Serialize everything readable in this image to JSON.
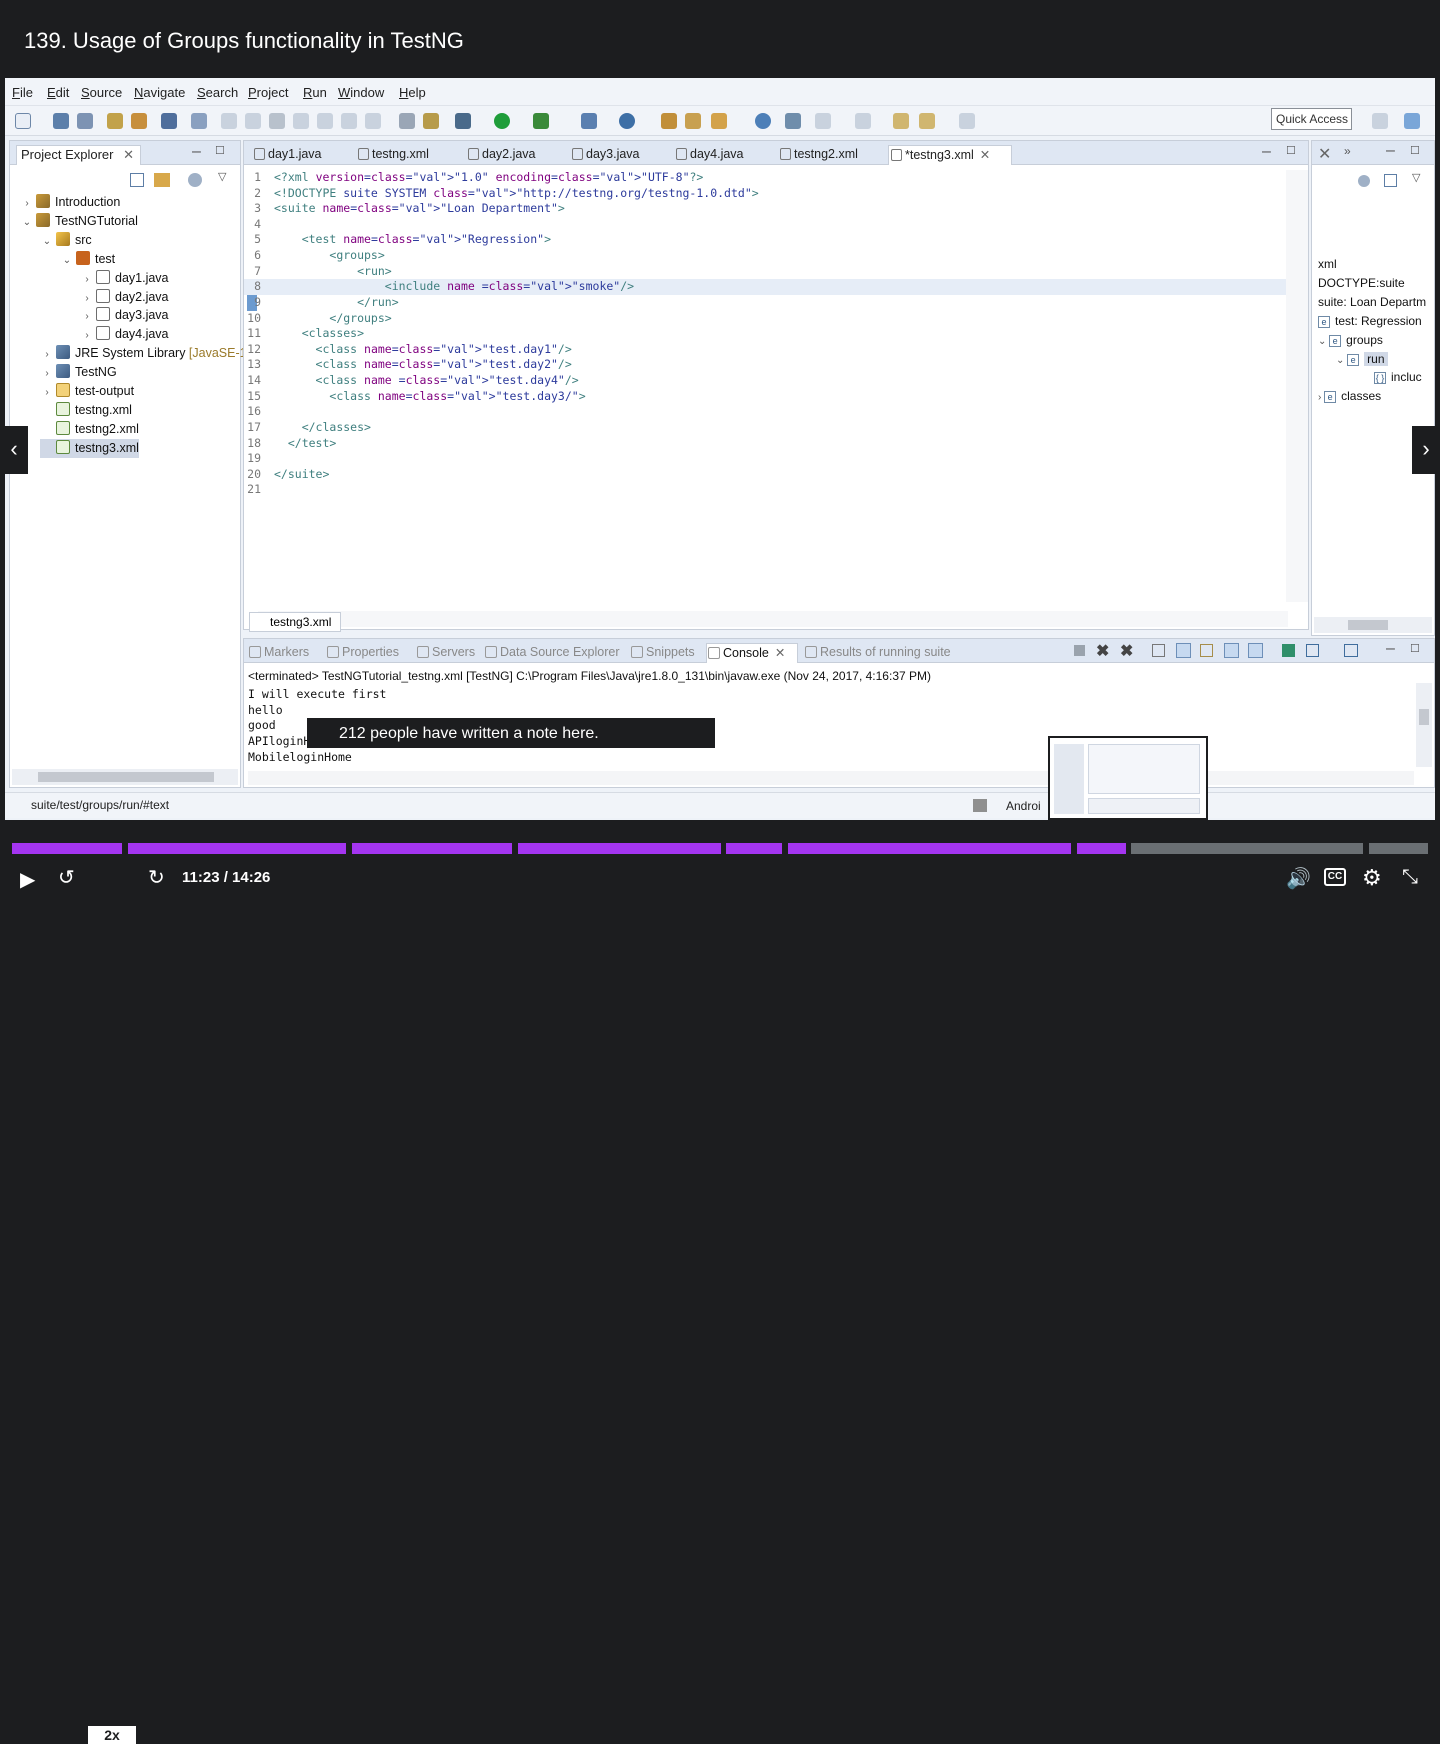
{
  "lecture": {
    "title": "139. Usage of Groups functionality in TestNG"
  },
  "menubar": {
    "items": [
      "File",
      "Edit",
      "Source",
      "Navigate",
      "Search",
      "Project",
      "Run",
      "Window",
      "Help"
    ]
  },
  "toolbar": {
    "quick_access": "Quick Access"
  },
  "project_explorer": {
    "tab_label": "Project Explorer",
    "items": [
      {
        "label": "Introduction",
        "depth": 0,
        "arrow": "›",
        "icon": "project-icon"
      },
      {
        "label": "TestNGTutorial",
        "depth": 0,
        "arrow": "⌄",
        "icon": "project-icon"
      },
      {
        "label": "src",
        "depth": 1,
        "arrow": "⌄",
        "icon": "source-folder-icon"
      },
      {
        "label": "test",
        "depth": 2,
        "arrow": "⌄",
        "icon": "package-icon"
      },
      {
        "label": "day1.java",
        "depth": 3,
        "arrow": "›",
        "icon": "java-file-icon"
      },
      {
        "label": "day2.java",
        "depth": 3,
        "arrow": "›",
        "icon": "java-file-icon"
      },
      {
        "label": "day3.java",
        "depth": 3,
        "arrow": "›",
        "icon": "java-file-icon"
      },
      {
        "label": "day4.java",
        "depth": 3,
        "arrow": "›",
        "icon": "java-file-icon"
      },
      {
        "label": "JRE System Library",
        "suffix": "[JavaSE-1.",
        "depth": 1,
        "arrow": "›",
        "icon": "library-icon"
      },
      {
        "label": "TestNG",
        "depth": 1,
        "arrow": "›",
        "icon": "library-icon"
      },
      {
        "label": "test-output",
        "depth": 1,
        "arrow": "›",
        "icon": "folder-icon"
      },
      {
        "label": "testng.xml",
        "depth": 1,
        "arrow": "",
        "icon": "xml-file-icon"
      },
      {
        "label": "testng2.xml",
        "depth": 1,
        "arrow": "",
        "icon": "xml-file-icon"
      },
      {
        "label": "testng3.xml",
        "depth": 1,
        "arrow": "",
        "icon": "xml-file-icon",
        "selected": true
      }
    ]
  },
  "editor": {
    "tabs": [
      "day1.java",
      "testng.xml",
      "day2.java",
      "day3.java",
      "day4.java",
      "testng2.xml",
      "*testng3.xml"
    ],
    "active_tab": "*testng3.xml",
    "bottom_tab": "testng3.xml",
    "highlighted_line": 8,
    "lines": [
      "<?xml version=\"1.0\" encoding=\"UTF-8\"?>",
      "<!DOCTYPE suite SYSTEM \"http://testng.org/testng-1.0.dtd\">",
      "<suite name=\"Loan Department\">",
      "",
      "    <test name=\"Regression\">",
      "        <groups>",
      "            <run>",
      "                <include name =\"smoke\"/>",
      "            </run>",
      "        </groups>",
      "    <classes>",
      "      <class name=\"test.day1\"/>",
      "      <class name=\"test.day2\"/>",
      "      <class name =\"test.day4\"/>",
      "        <class name=\"test.day3/\">",
      "",
      "    </classes>",
      "  </test>",
      "",
      "</suite>",
      ""
    ]
  },
  "outline": {
    "items": [
      {
        "label": "xml",
        "icon": ""
      },
      {
        "label": "DOCTYPE:suite",
        "icon": ""
      },
      {
        "label": "suite: Loan Departm",
        "icon": ""
      },
      {
        "label": "test: Regression",
        "icon": "e"
      },
      {
        "label": "groups",
        "icon": "e",
        "arrow": "⌄"
      },
      {
        "label": "run",
        "icon": "e",
        "arrow": "⌄"
      },
      {
        "label": "incluc",
        "icon": "{ }"
      },
      {
        "label": "classes",
        "icon": "e",
        "arrow": "›"
      }
    ]
  },
  "console": {
    "tabs": [
      "Markers",
      "Properties",
      "Servers",
      "Data Source Explorer",
      "Snippets",
      "Console",
      "Results of running suite"
    ],
    "active_tab": "Console",
    "header": "<terminated> TestNGTutorial_testng.xml [TestNG] C:\\Program Files\\Java\\jre1.8.0_131\\bin\\javaw.exe (Nov 24, 2017, 4:16:37 PM)",
    "output": "I will execute first\nhello\ngood\nAPIloginHome\nMobileloginHome"
  },
  "statusbar": {
    "path": "suite/test/groups/run/#text",
    "android": "Androi"
  },
  "note_banner": "212 people have written a note here.",
  "player": {
    "speed": "2x",
    "time": "11:23 / 14:26",
    "progress_fraction": 0.787,
    "colors": {
      "played": "#a435f0",
      "unplayed": "#6a6f73",
      "bg": "#1c1d1f"
    }
  }
}
